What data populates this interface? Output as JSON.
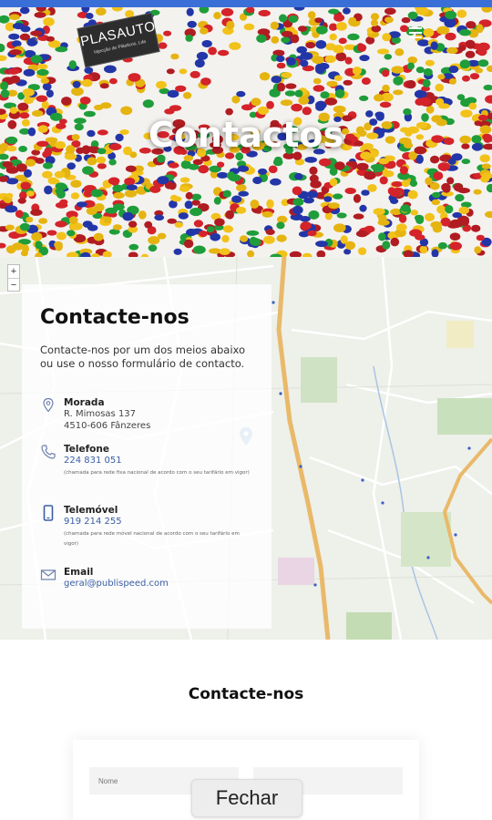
{
  "header": {
    "logo_brand": "PLASAUTO",
    "logo_tagline": "Injecção de Plásticos, Lda",
    "menu_icon": "hamburger-menu-icon"
  },
  "hero": {
    "title": "Contactos"
  },
  "map": {
    "zoom_in": "+",
    "zoom_out": "−"
  },
  "contact_card": {
    "title": "Contacte-nos",
    "intro": "Contacte-nos por um dos meios abaixo ou use o nosso formulário de contacto.",
    "address": {
      "icon": "location-pin-icon",
      "label": "Morada",
      "line1": "R. Mimosas 137",
      "line2": "4510-606 Fânzeres"
    },
    "phone": {
      "icon": "phone-icon",
      "label": "Telefone",
      "value": "224 831 051",
      "note": "(chamada para rede fixa nacional de acordo com o seu tarifário em vigor)"
    },
    "mobile": {
      "icon": "mobile-phone-icon",
      "label": "Telemóvel",
      "value": "919 214 255",
      "note": "(chamada para rede móvel nacional de acordo com o seu tarifário em vigor)"
    },
    "email": {
      "icon": "envelope-icon",
      "label": "Email",
      "value": "geral@publispeed.com"
    }
  },
  "form_section": {
    "title": "Contacte-nos",
    "name_placeholder": "Nome"
  },
  "close_button": {
    "label": "Fechar"
  },
  "colors": {
    "top_strip": "#3b6fd8",
    "link": "#3b5ea8",
    "road": "#e9b96a"
  }
}
